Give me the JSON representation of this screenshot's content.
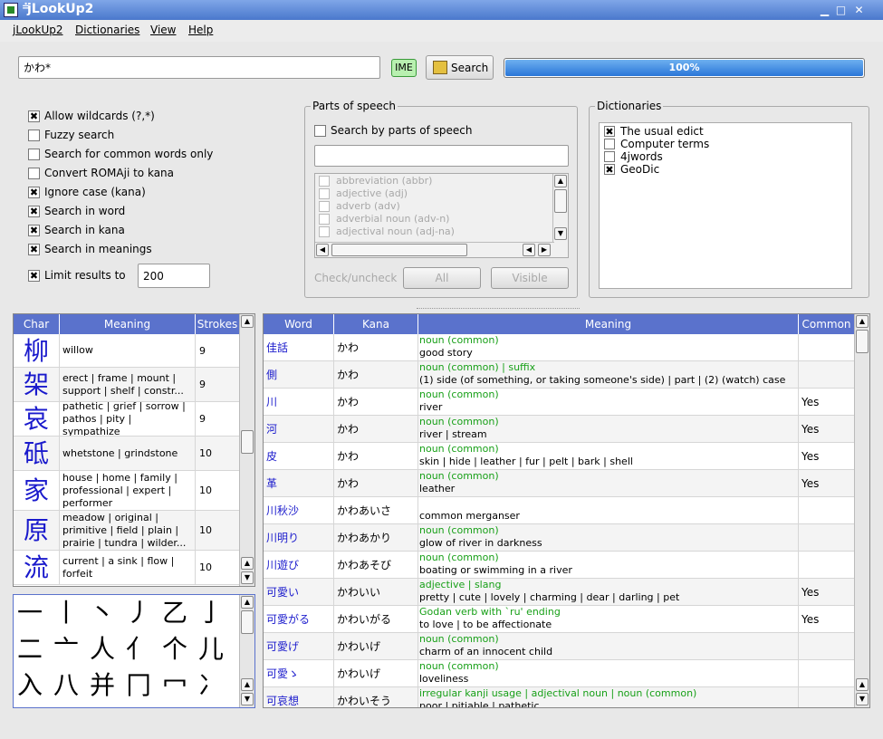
{
  "window": {
    "title": "jLookUp2"
  },
  "menu": [
    "jLookUp2",
    "Dictionaries",
    "View",
    "Help"
  ],
  "search": {
    "value": "かわ*",
    "ime_label": "IME",
    "search_label": "Search",
    "progress_text": "100%",
    "progress": 1.0
  },
  "options": [
    {
      "label": "Allow wildcards (?,*)",
      "checked": true
    },
    {
      "label": "Fuzzy search",
      "checked": false
    },
    {
      "label": "Search for common words only",
      "checked": false
    },
    {
      "label": "Convert ROMAji to kana",
      "checked": false
    },
    {
      "label": "Ignore case (kana)",
      "checked": true
    },
    {
      "label": "Search in word",
      "checked": true
    },
    {
      "label": "Search in kana",
      "checked": true
    },
    {
      "label": "Search in meanings",
      "checked": true
    }
  ],
  "limit": {
    "label": "Limit results to",
    "checked": true,
    "value": "200"
  },
  "pos": {
    "title": "Parts of speech",
    "search_label": "Search by parts of speech",
    "items": [
      "abbreviation (abbr)",
      "adjective (adj)",
      "adverb (adv)",
      "adverbial noun (adv-n)",
      "adjectival noun (adj-na)"
    ],
    "check_label": "Check/uncheck",
    "all_label": "All",
    "visible_label": "Visible"
  },
  "dictionaries": {
    "title": "Dictionaries",
    "items": [
      {
        "label": "The usual edict",
        "checked": true
      },
      {
        "label": "Computer terms",
        "checked": false
      },
      {
        "label": "4jwords",
        "checked": false
      },
      {
        "label": "GeoDic",
        "checked": true
      }
    ]
  },
  "kanji": {
    "headers": [
      "Char",
      "Meaning",
      "Strokes"
    ],
    "rows": [
      {
        "char": "柳",
        "meaning": "willow",
        "strokes": "9"
      },
      {
        "char": "架",
        "meaning": "erect | frame | mount | support | shelf | constr...",
        "strokes": "9"
      },
      {
        "char": "哀",
        "meaning": "pathetic | grief | sorrow | pathos | pity | sympathize",
        "strokes": "9"
      },
      {
        "char": "砥",
        "meaning": "whetstone | grindstone",
        "strokes": "10"
      },
      {
        "char": "家",
        "meaning": "house | home | family | professional | expert | performer",
        "strokes": "10"
      },
      {
        "char": "原",
        "meaning": "meadow | original | primitive | field | plain | prairie | tundra | wilder...",
        "strokes": "10"
      },
      {
        "char": "流",
        "meaning": "current | a sink | flow | forfeit",
        "strokes": "10"
      }
    ]
  },
  "radicals": [
    "一",
    "丨",
    "丶",
    "丿",
    "乙",
    "亅",
    "二",
    "亠",
    "人",
    "亻",
    "个",
    "儿",
    "入",
    "八",
    "并",
    "冂",
    "冖",
    "冫"
  ],
  "results": {
    "headers": [
      "Word",
      "Kana",
      "Meaning",
      "Common"
    ],
    "rows": [
      {
        "word": "佳話",
        "kana": "かわ",
        "pos": "noun (common)",
        "meaning": "good story",
        "common": ""
      },
      {
        "word": "側",
        "kana": "かわ",
        "pos": "noun (common) | suffix",
        "meaning": "(1) side (of something, or taking someone's side) | part | (2) (watch) case",
        "common": ""
      },
      {
        "word": "川",
        "kana": "かわ",
        "pos": "noun (common)",
        "meaning": "river",
        "common": "Yes"
      },
      {
        "word": "河",
        "kana": "かわ",
        "pos": "noun (common)",
        "meaning": "river | stream",
        "common": "Yes"
      },
      {
        "word": "皮",
        "kana": "かわ",
        "pos": "noun (common)",
        "meaning": "skin | hide | leather | fur | pelt | bark | shell",
        "common": "Yes"
      },
      {
        "word": "革",
        "kana": "かわ",
        "pos": "noun (common)",
        "meaning": "leather",
        "common": "Yes"
      },
      {
        "word": "川秋沙",
        "kana": "かわあいさ",
        "pos": "",
        "meaning": "common merganser",
        "common": ""
      },
      {
        "word": "川明り",
        "kana": "かわあかり",
        "pos": "noun (common)",
        "meaning": "glow of river in darkness",
        "common": ""
      },
      {
        "word": "川遊び",
        "kana": "かわあそび",
        "pos": "noun (common)",
        "meaning": "boating or swimming in a river",
        "common": ""
      },
      {
        "word": "可愛い",
        "kana": "かわいい",
        "pos": "adjective | slang",
        "meaning": "pretty | cute | lovely | charming | dear | darling | pet",
        "common": "Yes"
      },
      {
        "word": "可愛がる",
        "kana": "かわいがる",
        "pos": "Godan verb with `ru' ending",
        "meaning": "to love | to be affectionate",
        "common": "Yes"
      },
      {
        "word": "可愛げ",
        "kana": "かわいげ",
        "pos": "noun (common)",
        "meaning": "charm of an innocent child",
        "common": ""
      },
      {
        "word": "可愛ゝ",
        "kana": "かわいげ",
        "pos": "noun (common)",
        "meaning": "loveliness",
        "common": ""
      },
      {
        "word": "可哀想",
        "kana": "かわいそう",
        "pos": "irregular kanji usage | adjectival noun | noun (common)",
        "meaning": "poor | pitiable | pathetic",
        "common": ""
      }
    ]
  }
}
